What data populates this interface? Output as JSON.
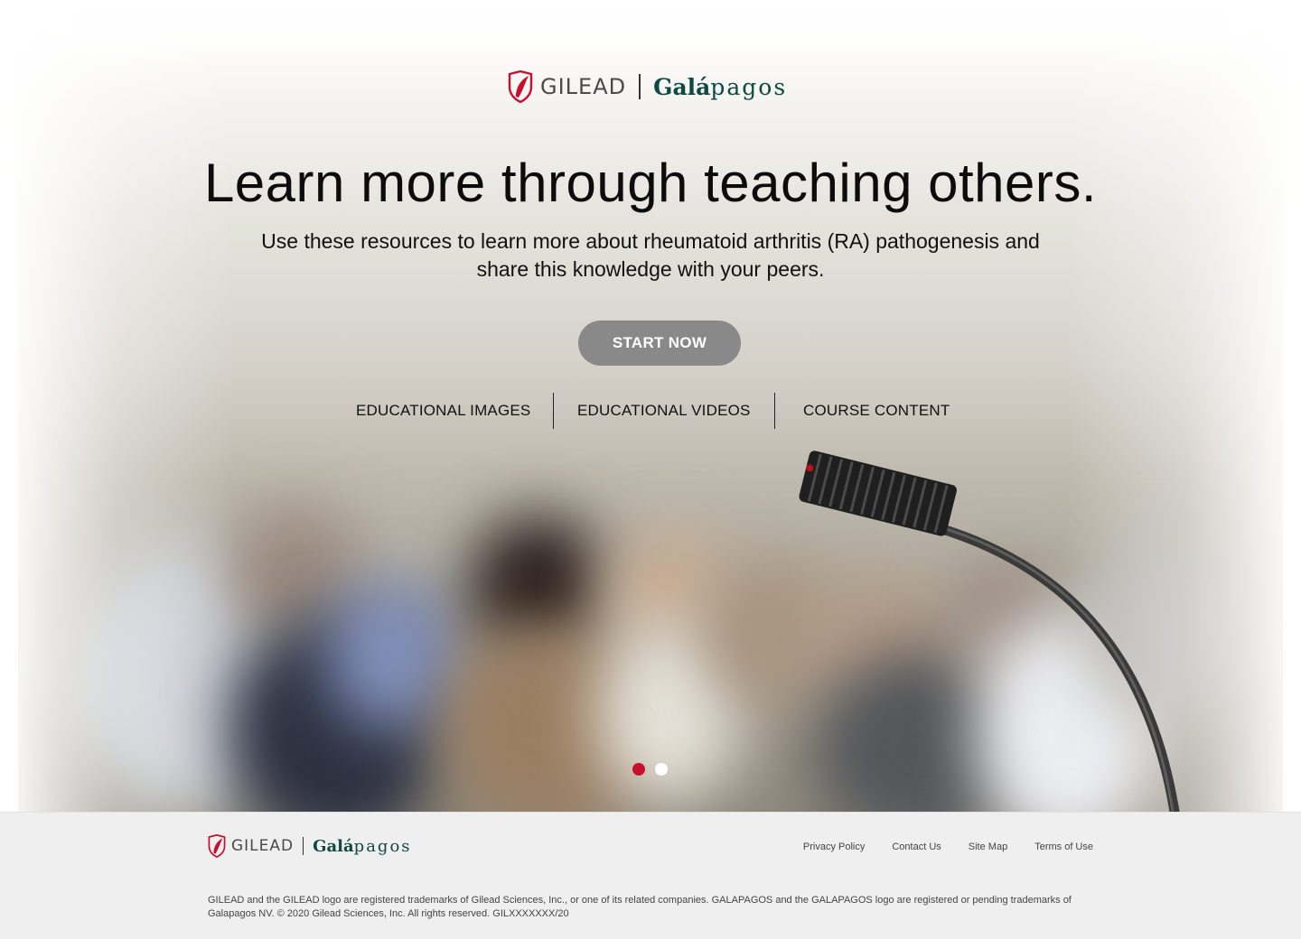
{
  "brand": {
    "gilead": "GILEAD",
    "galapagos_bold": "Galá",
    "galapagos_light": "pagos",
    "colors": {
      "gilead_red": "#c8102e",
      "galapagos_green": "#0f4a42"
    }
  },
  "hero": {
    "headline": "Learn more through teaching others.",
    "subhead": "Use these resources to learn more about rheumatoid arthritis (RA) pathogenesis and share this knowledge with your peers.",
    "cta_label": "START NOW",
    "cta_color": "#898989",
    "resource_links": [
      "EDUCATIONAL IMAGES",
      "EDUCATIONAL VIDEOS",
      "COURSE CONTENT"
    ],
    "carousel": {
      "slides": 2,
      "active_index": 0,
      "active_color": "#c8102e"
    }
  },
  "footer": {
    "links": [
      "Privacy Policy",
      "Contact Us",
      "Site Map",
      "Terms of Use"
    ],
    "legal": "GILEAD and the GILEAD logo are registered trademarks of Gilead Sciences, Inc., or one of its related companies. GALAPAGOS and the GALAPAGOS logo are registered or pending trademarks of Galapagos NV. © 2020 Gilead Sciences, Inc. All rights reserved. GILXXXXXXX/20"
  }
}
